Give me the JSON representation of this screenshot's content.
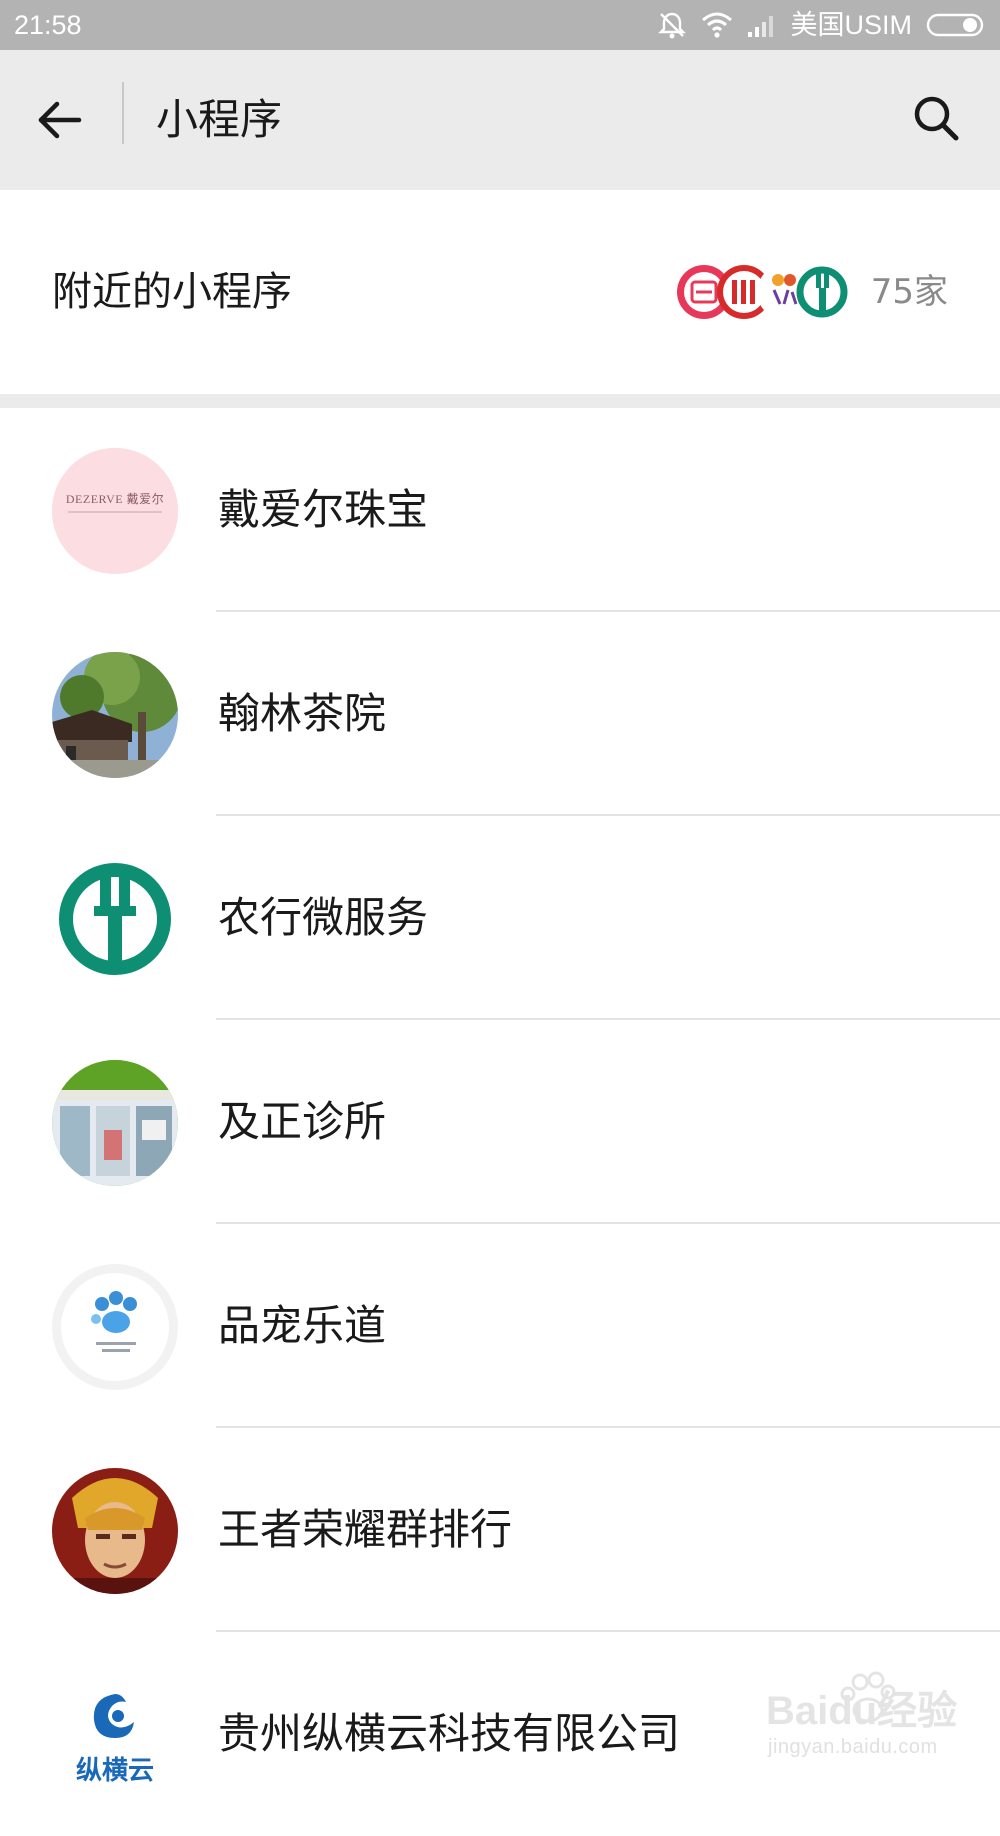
{
  "status_bar": {
    "time": "21:58",
    "carrier": "美国USIM",
    "icons": [
      "mute-icon",
      "wifi-icon",
      "signal-icon",
      "battery-icon"
    ]
  },
  "header": {
    "title": "小程序",
    "back_icon": "arrow-left-icon",
    "search_icon": "search-icon"
  },
  "nearby": {
    "label": "附近的小程序",
    "count": "75家",
    "icons": [
      "mini-program-logo-1",
      "mini-program-logo-2",
      "mini-program-logo-3",
      "abc-bank-logo"
    ]
  },
  "apps": [
    {
      "name": "戴爱尔珠宝",
      "avatar_text": "DEZERVE 戴爱尔",
      "avatar_icon": "jewelry-logo"
    },
    {
      "name": "翰林茶院",
      "avatar_icon": "teahouse-photo"
    },
    {
      "name": "农行微服务",
      "avatar_icon": "abc-bank-logo"
    },
    {
      "name": "及正诊所",
      "avatar_icon": "clinic-photo"
    },
    {
      "name": "品宠乐道",
      "avatar_icon": "paw-logo"
    },
    {
      "name": "王者荣耀群排行",
      "avatar_icon": "game-hero-avatar"
    },
    {
      "name": "贵州纵横云科技有限公司",
      "avatar_text": "纵横云",
      "avatar_icon": "zonghengyun-logo"
    }
  ],
  "watermark": {
    "brand": "Baidu经验",
    "url": "jingyan.baidu.com"
  },
  "colors": {
    "status_bar": "#b3b3b3",
    "header_bg": "#ebebeb",
    "abc_green": "#0e8f73",
    "text_primary": "#1a1a1a",
    "text_secondary": "#8a8a8a"
  }
}
